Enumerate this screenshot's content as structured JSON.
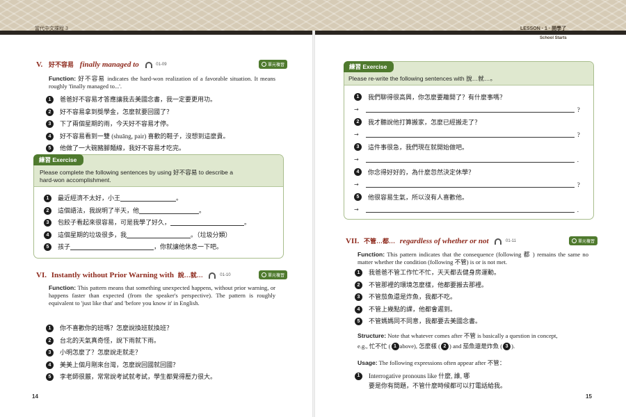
{
  "header": {
    "left_running_head": "當代中文課程 3",
    "right_lesson": "LESSON · 1 · 開學了",
    "right_subtitle": "School Starts"
  },
  "left": {
    "sec5": {
      "num": "V.",
      "zh": "好不容易",
      "en": "finally managed to",
      "track": "01-09",
      "badge": "單元複習",
      "function_label": "Function:",
      "function_text": " 好不容易 indicates the hard-won realization of a favorable situation. It means roughly 'finally managed to...'.",
      "examples": [
        "爸爸好不容易才答應讓我去美國念書，我一定要更用功。",
        "好不容易拿到獎學金，怎麼就要回國了？",
        "下了兩個星期的雨，今天好不容易才停。",
        "好不容易看到一雙 (shuāng, pair) 喜歡的鞋子，沒想到這麼貴。",
        "他做了一大碗豬腳麵線，我好不容易才吃完。"
      ]
    },
    "exercise": {
      "tab": "練習 Exercise",
      "instr1": "Please complete the following sentences by using 好不容易 to describe a",
      "instr2": "hard-won accomplishment.",
      "items": [
        {
          "pre": "最近經濟不太好，小王",
          "post": "。"
        },
        {
          "pre": "這個語法，我說明了半天，他",
          "post": "。"
        },
        {
          "pre": "包餃子看起來很容易，可是我學了好久，",
          "post": "。"
        },
        {
          "pre": "這個星期的垃圾很多，我",
          "post": "。（垃圾分類）"
        },
        {
          "pre": "孩子",
          "post": "，你就讓他休息一下吧。"
        }
      ]
    },
    "sec6": {
      "num": "VI.",
      "en": "Instantly without Prior Warning with",
      "zh": "說…就…",
      "track": "01-10",
      "badge": "單元複習",
      "function_label": "Function:",
      "function_text": " This pattern means that something unexpected happens, without prior warning, or happens faster than expected (from the speaker's perspective). The pattern is roughly equivalent to 'just like that' and 'before you know it' in English.",
      "examples": [
        "你不喜歡你的班嗎？怎麼說換班就換班？",
        "台北的天氣真奇怪，說下雨就下雨。",
        "小明怎麼了？怎麼說走就走？",
        "美美上個月剛來台灣，怎麼說回國就回國？",
        "李老師很嚴，常常說考試就考試，學生都覺得壓力很大。"
      ]
    },
    "page_number": "14"
  },
  "right": {
    "exercise": {
      "tab": "練習 Exercise",
      "instr": "Please re-write the following sentences with 說…就…。",
      "items": [
        "我們聊得很高興，你怎麼要離開了？有什麼事嗎？",
        "我才聽說他打算搬家，怎麼已經搬走了？",
        "這件事很急，我們現在就開始做吧。",
        "你念得好好的，為什麼忽然決定休學？",
        "他很容易生氣，所以沒有人喜歡他。"
      ],
      "endings": [
        "?",
        "?",
        ".",
        "?",
        "."
      ]
    },
    "sec7": {
      "num": "VII.",
      "zh": "不管…都…",
      "en": "regardless of whether or not",
      "track": "01-11",
      "badge": "單元複習",
      "function_label": "Function:",
      "function_text": " This pattern indicates that the consequence (following 都 ) remains the same no matter whether the condition (following 不管) is or is not met.",
      "examples": [
        "我爸爸不管工作忙不忙，天天都去健身房運動。",
        "不管那裡的環境怎麼樣，他都要搬去那裡。",
        "不管茄魚還是炸魚，我都不吃。",
        "不管上幾點的課，他都會遲到。",
        "不管媽媽同不同意，我都要去美國念書。"
      ],
      "structure_label": "Structure:",
      "structure_text": " Note that whatever comes after 不管 is basically a question in concept,",
      "structure_text2_a": "e.g., 忙不忙 (",
      "structure_text2_b": " above), 怎麼樣 (",
      "structure_text2_c": ") and 茄魚還是炸魚 (",
      "structure_text2_d": ").",
      "usage_label": "Usage:",
      "usage_text": " The following expressions often appear after 不管：",
      "usage_items": [
        {
          "line1": "Interrogative pronouns like 什麼, 誰, 哪",
          "line2": "要是你有問題，不管什麼時候都可以打電話給我。"
        }
      ]
    },
    "page_number": "15"
  },
  "colors": {
    "accent_red": "#8e2a1d",
    "green": "#4f7a2e",
    "light_green": "#dfe8cf"
  }
}
